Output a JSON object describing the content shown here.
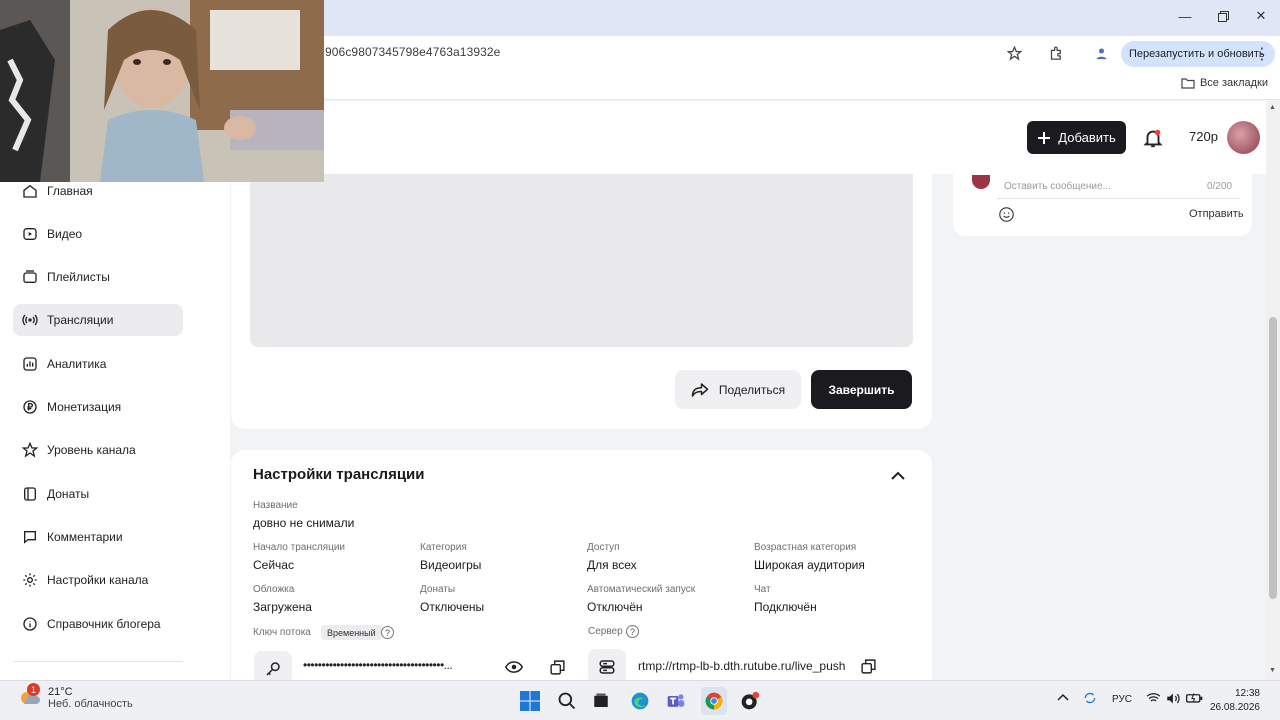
{
  "browser": {
    "url": "906c9807345798e4763a13932e",
    "relaunch_label": "Перезапустить и обновить",
    "all_bookmarks": "Все закладки"
  },
  "header": {
    "add_label": "Добавить",
    "quality": "720p"
  },
  "sidebar": {
    "items": [
      {
        "label": "Главная",
        "icon": "home-icon"
      },
      {
        "label": "Видео",
        "icon": "video-icon"
      },
      {
        "label": "Плейлисты",
        "icon": "playlist-icon"
      },
      {
        "label": "Трансляции",
        "icon": "broadcast-icon",
        "active": true
      },
      {
        "label": "Аналитика",
        "icon": "analytics-icon"
      },
      {
        "label": "Монетизация",
        "icon": "ruble-icon"
      },
      {
        "label": "Уровень канала",
        "icon": "star-icon"
      },
      {
        "label": "Донаты",
        "icon": "donate-icon"
      },
      {
        "label": "Комментарии",
        "icon": "comment-icon"
      },
      {
        "label": "Настройки канала",
        "icon": "gear-icon"
      },
      {
        "label": "Справочник блогера",
        "icon": "info-icon"
      }
    ]
  },
  "player": {
    "share_label": "Поделиться",
    "end_label": "Завершить"
  },
  "chat": {
    "placeholder": "Оставить сообщение...",
    "counter": "0/200",
    "send_label": "Отправить"
  },
  "settings": {
    "title": "Настройки трансляции",
    "name_label": "Название",
    "name_value": "довно не снимали",
    "fields": [
      {
        "label": "Начало трансляции",
        "value": "Сейчас"
      },
      {
        "label": "Категория",
        "value": "Видеоигры"
      },
      {
        "label": "Доступ",
        "value": "Для всех"
      },
      {
        "label": "Возрастная категория",
        "value": "Широкая аудитория"
      },
      {
        "label": "Обложка",
        "value": "Загружена"
      },
      {
        "label": "Донаты",
        "value": "Отключены"
      },
      {
        "label": "Автоматический запуск",
        "value": "Отключён"
      },
      {
        "label": "Чат",
        "value": "Подключён"
      }
    ],
    "stream_key_label": "Ключ потока",
    "stream_key_badge": "Временный",
    "stream_key_masked": "••••••••••••••••••••••••••••••••••••••...",
    "server_label": "Сервер",
    "server_url": "rtmp://rtmp-lb-b.dth.rutube.ru/live_push",
    "help_glyph": "?"
  },
  "taskbar": {
    "weather_temp": "21°C",
    "weather_desc": "Неб. облачность",
    "weather_badge": "1",
    "lang": "РУС",
    "time": "12:38",
    "date": "26.08.2026"
  },
  "colors": {
    "accent_dark": "#1b1b1f",
    "page_bg": "#f2f3f5",
    "active_nav": "#ececee",
    "relaunch_bg": "#d3e3fd"
  }
}
